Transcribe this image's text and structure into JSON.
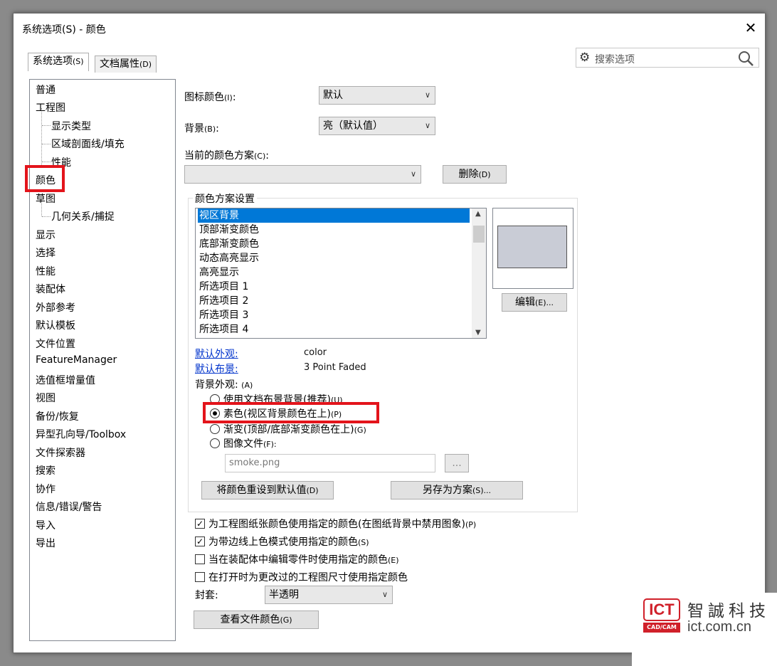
{
  "window": {
    "title": "系统选项(S) - 颜色",
    "close": "✕",
    "tabs": [
      {
        "label": "系统选项",
        "key": "(S)"
      },
      {
        "label": "文档属性",
        "key": "(D)"
      }
    ],
    "search_placeholder": "搜索选项"
  },
  "sidebar": {
    "items": [
      "普通",
      "工程图",
      "显示类型",
      "区域剖面线/填充",
      "性能",
      "颜色",
      "草图",
      "几何关系/捕捉",
      "显示",
      "选择",
      "性能",
      "装配体",
      "外部参考",
      "默认模板",
      "文件位置",
      "FeatureManager",
      "选值框增量值",
      "视图",
      "备份/恢复",
      "异型孔向导/Toolbox",
      "文件探索器",
      "搜索",
      "协作",
      "信息/错误/警告",
      "导入",
      "导出"
    ]
  },
  "main": {
    "icon_color_label": "图标颜色",
    "icon_color_key": "(I)",
    "icon_color_value": "默认",
    "background_label": "背景",
    "background_key": "(B)",
    "background_value": "亮（默认值）",
    "current_scheme_label": "当前的颜色方案",
    "current_scheme_key": "(C)",
    "current_scheme_value": "",
    "delete_label": "删除",
    "delete_key": "(D)",
    "group_title": "颜色方案设置",
    "list_items": [
      "视区背景",
      "顶部渐变颜色",
      "底部渐变颜色",
      "动态高亮显示",
      "高亮显示",
      "所选项目 1",
      "所选项目 2",
      "所选项目 3",
      "所选项目 4"
    ],
    "edit_label": "编辑",
    "edit_key": "(E)...",
    "default_appearance_link": "默认外观:",
    "default_appearance_value": "color",
    "default_scene_link": "默认布景:",
    "default_scene_value": "3 Point Faded",
    "bg_appearance_label": "背景外观:",
    "bg_appearance_key": "(A)",
    "radios": [
      {
        "label": "使用文档布景背景(推荐)",
        "key": "(U)"
      },
      {
        "label": "素色(视区背景颜色在上)",
        "key": "(P)"
      },
      {
        "label": "渐变(顶部/底部渐变颜色在上)",
        "key": "(G)"
      },
      {
        "label": "图像文件",
        "key": "(F):"
      }
    ],
    "image_file_value": "smoke.png",
    "browse_label": "...",
    "reset_label": "将颜色重设到默认值",
    "reset_key": "(D)",
    "save_scheme_label": "另存为方案",
    "save_scheme_key": "(S)...",
    "checkboxes": [
      {
        "label": "为工程图纸张颜色使用指定的颜色(在图纸背景中禁用图象)",
        "key": "(P)",
        "checked": true
      },
      {
        "label": "为带边线上色模式使用指定的颜色",
        "key": "(S)",
        "checked": true
      },
      {
        "label": "当在装配体中编辑零件时使用指定的颜色",
        "key": "(E)",
        "checked": false
      },
      {
        "label": "在打开时为更改过的工程图尺寸使用指定颜色",
        "key": "",
        "checked": false
      }
    ],
    "envelope_label": "封套:",
    "envelope_value": "半透明",
    "view_doc_colors_label": "查看文件颜色",
    "view_doc_colors_key": "(G)"
  },
  "logo": {
    "mark": "ICT",
    "sub": "CAD/CAM",
    "name": "智誠科技",
    "domain": "ict.com.cn"
  },
  "colors": {
    "highlight": "#e3141b",
    "selection": "#0078d7",
    "link": "#0033cc"
  }
}
